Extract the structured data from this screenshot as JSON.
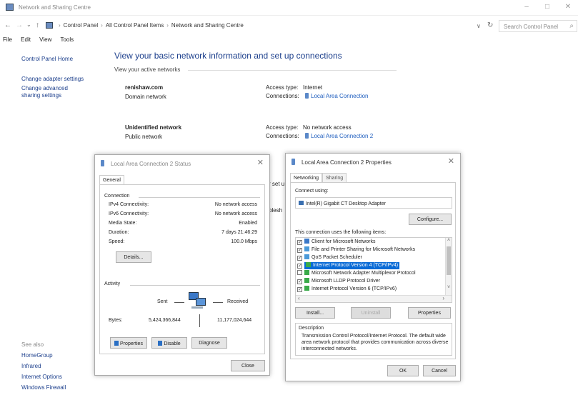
{
  "window": {
    "title": "Network and Sharing Centre",
    "controls": {
      "minimize": "–",
      "maximize": "□",
      "close": "✕"
    }
  },
  "address": {
    "back": "←",
    "forward": "→",
    "recent": "⌄",
    "up": "↑",
    "crumbs": [
      "Control Panel",
      "All Control Panel Items",
      "Network and Sharing Centre"
    ],
    "dropdown": "∨",
    "refresh": "↻",
    "search_placeholder": "Search Control Panel",
    "search_icon": "⌕"
  },
  "menu": [
    "File",
    "Edit",
    "View",
    "Tools"
  ],
  "leftnav": {
    "home": "Control Panel Home",
    "adapter": "Change adapter settings",
    "sharing": "Change advanced sharing settings"
  },
  "see_also": {
    "heading": "See also",
    "links": [
      "HomeGroup",
      "Infrared",
      "Internet Options",
      "Windows Firewall"
    ]
  },
  "main": {
    "heading": "View your basic network information and set up connections",
    "active_networks": "View your active networks",
    "networks": [
      {
        "name": "renishaw.com",
        "type": "Domain network",
        "access_label": "Access type:",
        "access": "Internet",
        "conn_label": "Connections:",
        "conn": "Local Area Connection"
      },
      {
        "name": "Unidentified network",
        "type": "Public network",
        "access_label": "Access type:",
        "access": "No network access",
        "conn_label": "Connections:",
        "conn": "Local Area Connection 2"
      }
    ],
    "partial1": "r set u",
    "partial2": "blesh"
  },
  "status_dialog": {
    "title": "Local Area Connection 2 Status",
    "close": "✕",
    "tab": "General",
    "connection_heading": "Connection",
    "rows": [
      {
        "label": "IPv4 Connectivity:",
        "value": "No network access"
      },
      {
        "label": "IPv6 Connectivity:",
        "value": "No network access"
      },
      {
        "label": "Media State:",
        "value": "Enabled"
      },
      {
        "label": "Duration:",
        "value": "7 days 21:46:29"
      },
      {
        "label": "Speed:",
        "value": "100.0 Mbps"
      }
    ],
    "details": "Details...",
    "activity_heading": "Activity",
    "sent": "Sent",
    "received": "Received",
    "bytes_label": "Bytes:",
    "bytes_sent": "5,424,366,844",
    "bytes_received": "11,177,024,644",
    "properties": "Properties",
    "disable": "Disable",
    "diagnose": "Diagnose",
    "close_btn": "Close"
  },
  "props_dialog": {
    "title": "Local Area Connection 2 Properties",
    "close": "✕",
    "tabs": [
      "Networking",
      "Sharing"
    ],
    "connect_using": "Connect using:",
    "adapter": "Intel(R) Gigabit CT Desktop Adapter",
    "configure": "Configure...",
    "uses_items": "This connection uses the following items:",
    "items": [
      {
        "label": "Client for Microsoft Networks",
        "checked": "✓"
      },
      {
        "label": "File and Printer Sharing for Microsoft Networks",
        "checked": "✓"
      },
      {
        "label": "QoS Packet Scheduler",
        "checked": "✓"
      },
      {
        "label": "Internet Protocol Version 4 (TCP/IPv4)",
        "checked": "✓"
      },
      {
        "label": "Microsoft Network Adapter Multiplexor Protocol",
        "checked": ""
      },
      {
        "label": "Microsoft LLDP Protocol Driver",
        "checked": "✓"
      },
      {
        "label": "Internet Protocol Version 6 (TCP/IPv6)",
        "checked": "✓"
      }
    ],
    "install": "Install...",
    "uninstall": "Uninstall",
    "properties": "Properties",
    "description_heading": "Description",
    "description": "Transmission Control Protocol/Internet Protocol. The default wide area network protocol that provides communication across diverse interconnected networks.",
    "ok": "OK",
    "cancel": "Cancel",
    "scroll_up": "˄",
    "scroll_down": "˅",
    "scroll_left": "‹",
    "scroll_right": "›"
  },
  "colors": {
    "link": "#1c5cbe",
    "heading": "#1c3f8c",
    "selection": "#0a6bd6"
  }
}
